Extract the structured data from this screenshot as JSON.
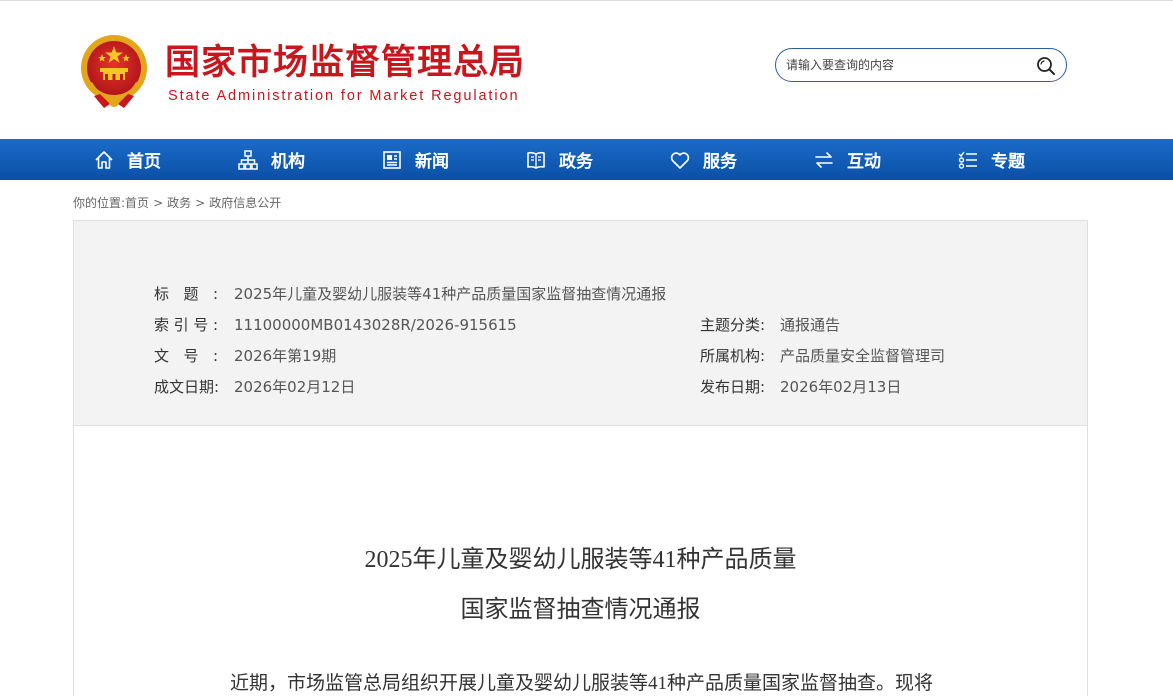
{
  "header": {
    "title_cn": "国家市场监督管理总局",
    "title_en": "State Administration for Market Regulation",
    "brand_color": "#c8161d"
  },
  "search": {
    "placeholder": "请输入要查询的内容",
    "icon": "search-icon"
  },
  "nav": {
    "color": "#0b4fa6",
    "items": [
      {
        "label": "首页",
        "icon": "home-icon"
      },
      {
        "label": "机构",
        "icon": "org-chart-icon"
      },
      {
        "label": "新闻",
        "icon": "news-icon"
      },
      {
        "label": "政务",
        "icon": "book-icon"
      },
      {
        "label": "服务",
        "icon": "heart-icon"
      },
      {
        "label": "互动",
        "icon": "swap-arrows-icon"
      },
      {
        "label": "专题",
        "icon": "topics-list-icon"
      }
    ]
  },
  "breadcrumb": {
    "prefix": "你的位置:",
    "items": [
      "首页",
      "政务",
      "政府信息公开"
    ],
    "separator": ">"
  },
  "info": {
    "title_label": "标题:",
    "title_value": "2025年儿童及婴幼儿服装等41种产品质量国家监督抽查情况通报",
    "index_label": "索引号:",
    "index_value": "11100000MB0143028R/2026-915615",
    "doc_no_label": "文号:",
    "doc_no_value": "2026年第19期",
    "created_label": "成文日期:",
    "created_value": "2026年02月12日",
    "category_label": "主题分类:",
    "category_value": "通报通告",
    "org_label": "所属机构:",
    "org_value": "产品质量安全监督管理司",
    "published_label": "发布日期:",
    "published_value": "2026年02月13日"
  },
  "article": {
    "title_line1": "2025年儿童及婴幼儿服装等41种产品质量",
    "title_line2": "国家监督抽查情况通报",
    "body_start": "近期，市场监管总局组织开展儿童及婴幼儿服装等41种产品质量国家监督抽查。现将"
  }
}
